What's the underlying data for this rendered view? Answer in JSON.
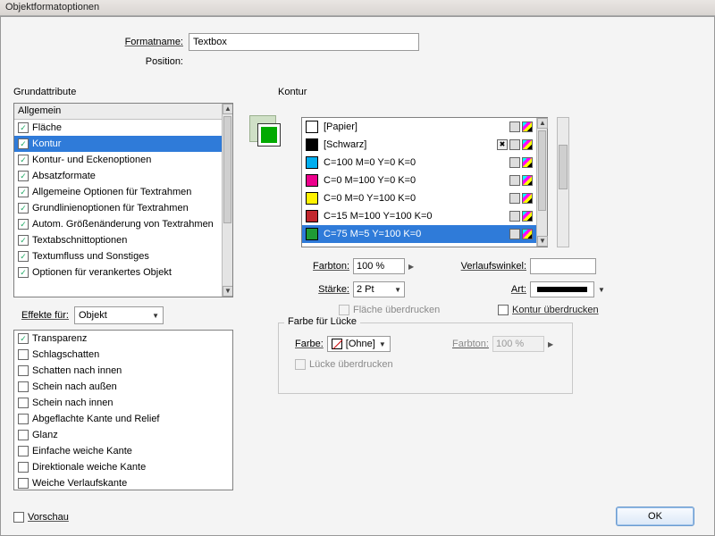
{
  "title": "Objektformatoptionen",
  "formatname": {
    "label": "Formatname:",
    "value": "Textbox"
  },
  "position_label": "Position:",
  "grund": {
    "title": "Grundattribute",
    "header": "Allgemein",
    "items": [
      {
        "label": "Fläche",
        "checked": true,
        "selected": false
      },
      {
        "label": "Kontur",
        "checked": true,
        "selected": true
      },
      {
        "label": "Kontur- und Eckenoptionen",
        "checked": true,
        "selected": false
      },
      {
        "label": "Absatzformate",
        "checked": true,
        "selected": false
      },
      {
        "label": "Allgemeine Optionen für Textrahmen",
        "checked": true,
        "selected": false
      },
      {
        "label": "Grundlinienoptionen für Textrahmen",
        "checked": true,
        "selected": false
      },
      {
        "label": "Autom. Größenänderung von Textrahmen",
        "checked": true,
        "selected": false
      },
      {
        "label": "Textabschnittoptionen",
        "checked": true,
        "selected": false
      },
      {
        "label": "Textumfluss und Sonstiges",
        "checked": true,
        "selected": false
      },
      {
        "label": "Optionen für verankertes Objekt",
        "checked": true,
        "selected": false
      }
    ]
  },
  "effekte": {
    "label": "Effekte für:",
    "value": "Objekt",
    "items": [
      {
        "label": "Transparenz",
        "checked": true
      },
      {
        "label": "Schlagschatten",
        "checked": false
      },
      {
        "label": "Schatten nach innen",
        "checked": false
      },
      {
        "label": "Schein nach außen",
        "checked": false
      },
      {
        "label": "Schein nach innen",
        "checked": false
      },
      {
        "label": "Abgeflachte Kante und Relief",
        "checked": false
      },
      {
        "label": "Glanz",
        "checked": false
      },
      {
        "label": "Einfache weiche Kante",
        "checked": false
      },
      {
        "label": "Direktionale weiche Kante",
        "checked": false
      },
      {
        "label": "Weiche Verlaufskante",
        "checked": false
      }
    ]
  },
  "kontur": {
    "title": "Kontur",
    "swatches": [
      {
        "name": "[Papier]",
        "color": "#ffffff",
        "selected": false,
        "noedit": false
      },
      {
        "name": "[Schwarz]",
        "color": "#000000",
        "selected": false,
        "noedit": true
      },
      {
        "name": "C=100 M=0 Y=0 K=0",
        "color": "#00aeef",
        "selected": false,
        "noedit": false
      },
      {
        "name": "C=0 M=100 Y=0 K=0",
        "color": "#ec008c",
        "selected": false,
        "noedit": false
      },
      {
        "name": "C=0 M=0 Y=100 K=0",
        "color": "#fff200",
        "selected": false,
        "noedit": false
      },
      {
        "name": "C=15 M=100 Y=100 K=0",
        "color": "#c1272d",
        "selected": false,
        "noedit": false
      },
      {
        "name": "C=75 M=5 Y=100 K=0",
        "color": "#1f9b35",
        "selected": true,
        "noedit": false
      }
    ],
    "farbton": {
      "label": "Farbton:",
      "value": "100 %"
    },
    "staerke": {
      "label": "Stärke:",
      "value": "2 Pt"
    },
    "verlauf": {
      "label": "Verlaufswinkel:",
      "value": ""
    },
    "art": {
      "label": "Art:"
    },
    "flaeche_over": "Fläche überdrucken",
    "kontur_over": "Kontur überdrucken"
  },
  "gap": {
    "legend": "Farbe für Lücke",
    "farbe_label": "Farbe:",
    "farbe_value": "[Ohne]",
    "farbton_label": "Farbton:",
    "farbton_value": "100 %",
    "over": "Lücke überdrucken"
  },
  "preview": "Vorschau",
  "ok": "OK"
}
